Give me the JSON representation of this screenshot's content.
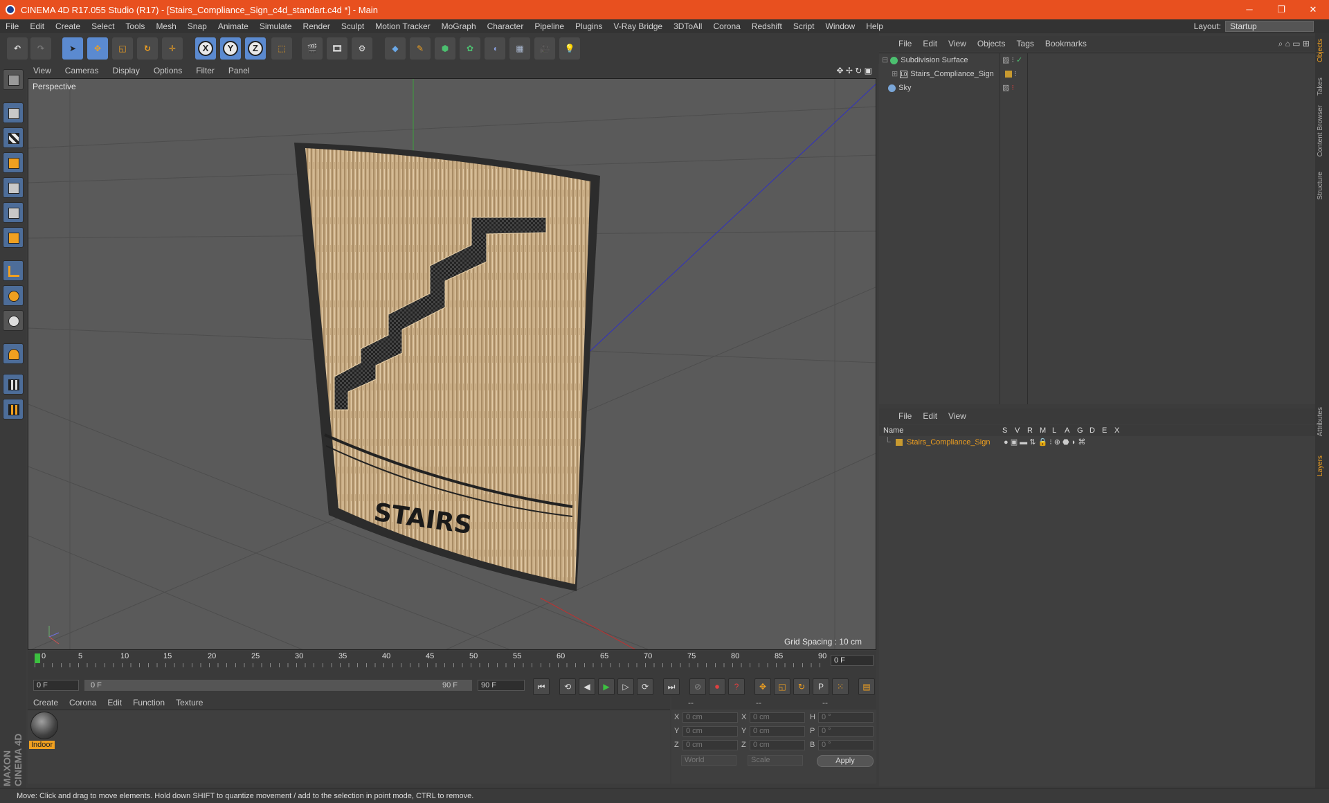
{
  "window": {
    "title": "CINEMA 4D R17.055 Studio (R17) - [Stairs_Compliance_Sign_c4d_standart.c4d *] - Main",
    "controls": [
      "─",
      "❐",
      "✕"
    ]
  },
  "menubar": {
    "items": [
      "File",
      "Edit",
      "Create",
      "Select",
      "Tools",
      "Mesh",
      "Snap",
      "Animate",
      "Simulate",
      "Render",
      "Sculpt",
      "Motion Tracker",
      "MoGraph",
      "Character",
      "Pipeline",
      "Plugins",
      "V-Ray Bridge",
      "3DToAll",
      "Corona",
      "Redshift",
      "Script",
      "Window",
      "Help"
    ],
    "layout_label": "Layout:",
    "layout_value": "Startup"
  },
  "toolbar": {
    "axis_x": "X",
    "axis_y": "Y",
    "axis_z": "Z"
  },
  "viewport": {
    "menu": [
      "View",
      "Cameras",
      "Display",
      "Options",
      "Filter",
      "Panel"
    ],
    "label": "Perspective",
    "grid_spacing": "Grid Spacing : 10 cm",
    "sign_text": "STAIRS"
  },
  "timeline": {
    "ticks": [
      "0",
      "5",
      "10",
      "15",
      "20",
      "25",
      "30",
      "35",
      "40",
      "45",
      "50",
      "55",
      "60",
      "65",
      "70",
      "75",
      "80",
      "85",
      "90"
    ],
    "current_frame": "0 F",
    "start_field": "0 F",
    "range_start": "0 F",
    "range_end": "90 F",
    "end_field": "90 F"
  },
  "material_manager": {
    "menu": [
      "Create",
      "Corona",
      "Edit",
      "Function",
      "Texture"
    ],
    "material_name": "Indoor"
  },
  "coordinates": {
    "headers": [
      "--",
      "--",
      "--"
    ],
    "rows": [
      {
        "l1": "X",
        "v1": "0 cm",
        "l2": "X",
        "v2": "0 cm",
        "l3": "H",
        "v3": "0 °"
      },
      {
        "l1": "Y",
        "v1": "0 cm",
        "l2": "Y",
        "v2": "0 cm",
        "l3": "P",
        "v3": "0 °"
      },
      {
        "l1": "Z",
        "v1": "0 cm",
        "l2": "Z",
        "v2": "0 cm",
        "l3": "B",
        "v3": "0 °"
      }
    ],
    "mode": "World",
    "scale": "Scale",
    "apply": "Apply"
  },
  "object_manager": {
    "menu": [
      "File",
      "Edit",
      "View",
      "Objects",
      "Tags",
      "Bookmarks"
    ],
    "objects": [
      "Subdivision Surface",
      "Stairs_Compliance_Sign",
      "Sky"
    ]
  },
  "layer_manager": {
    "menu": [
      "File",
      "Edit",
      "View"
    ],
    "columns": [
      "Name",
      "S",
      "V",
      "R",
      "M",
      "L",
      "A",
      "G",
      "D",
      "E",
      "X"
    ],
    "layer": "Stairs_Compliance_Sign"
  },
  "side_tabs": [
    "Objects",
    "Takes",
    "Content Browser",
    "Structure",
    "Attributes",
    "Layers"
  ],
  "status": "Move: Click and drag to move elements. Hold down SHIFT to quantize movement / add to the selection in point mode, CTRL to remove.",
  "brand": "MAXON CINEMA 4D"
}
